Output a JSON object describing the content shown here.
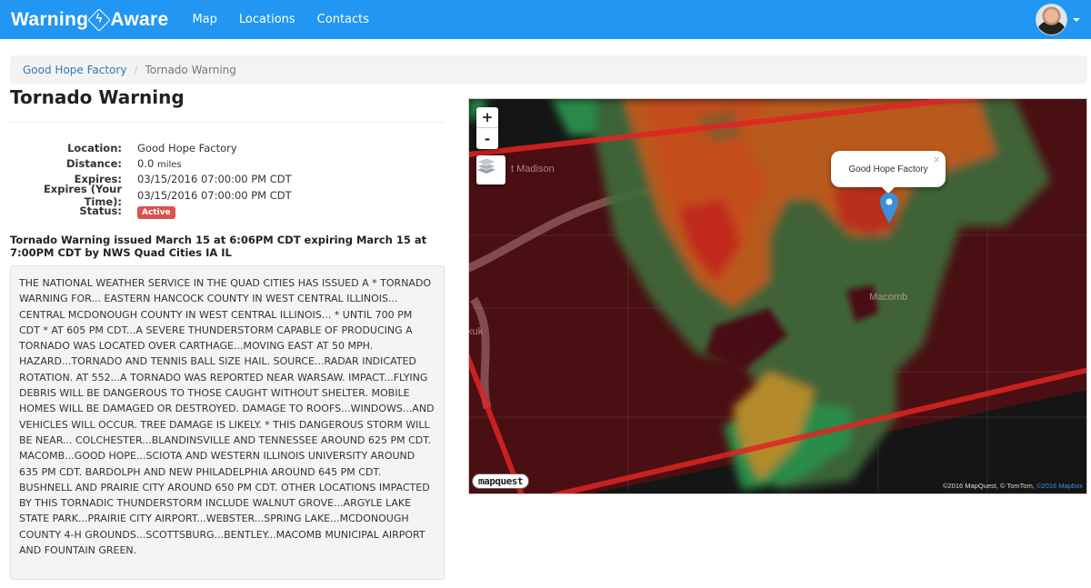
{
  "navbar": {
    "brand_part1": "Warning",
    "brand_part2": "Aware",
    "brand_icon": "lightning-bolt-icon",
    "links": [
      "Map",
      "Locations",
      "Contacts"
    ],
    "accent_color": "#2196f3"
  },
  "breadcrumb": {
    "parent": "Good Hope Factory",
    "separator": "/",
    "current": "Tornado Warning"
  },
  "page": {
    "title": "Tornado Warning"
  },
  "details": {
    "location_label": "Location:",
    "location_value": "Good Hope Factory",
    "distance_label": "Distance:",
    "distance_value": "0.0",
    "distance_unit": "miles",
    "expires_label": "Expires:",
    "expires_value": "03/15/2016 07:00:00 PM CDT",
    "expires_local_label": "Expires (Your Time):",
    "expires_local_value": "03/15/2016 07:00:00 PM CDT",
    "status_label": "Status:",
    "status_value": "Active",
    "status_color": "#d9534f"
  },
  "alert": {
    "headline": "Tornado Warning issued March 15 at 6:06PM CDT expiring March 15 at 7:00PM CDT by NWS Quad Cities IA IL",
    "body": "THE NATIONAL WEATHER SERVICE IN THE QUAD CITIES HAS ISSUED A * TORNADO WARNING FOR... EASTERN HANCOCK COUNTY IN WEST CENTRAL ILLINOIS... CENTRAL MCDONOUGH COUNTY IN WEST CENTRAL ILLINOIS... * UNTIL 700 PM CDT * AT 605 PM CDT...A SEVERE THUNDERSTORM CAPABLE OF PRODUCING A TORNADO WAS LOCATED OVER CARTHAGE...MOVING EAST AT 50 MPH. HAZARD...TORNADO AND TENNIS BALL SIZE HAIL. SOURCE...RADAR INDICATED ROTATION. AT 552...A TORNADO WAS REPORTED NEAR WARSAW. IMPACT...FLYING DEBRIS WILL BE DANGEROUS TO THOSE CAUGHT WITHOUT SHELTER. MOBILE HOMES WILL BE DAMAGED OR DESTROYED. DAMAGE TO ROOFS...WINDOWS...AND VEHICLES WILL OCCUR. TREE DAMAGE IS LIKELY. * THIS DANGEROUS STORM WILL BE NEAR... COLCHESTER...BLANDINSVILLE AND TENNESSEE AROUND 625 PM CDT. MACOMB...GOOD HOPE...SCIOTA AND WESTERN ILLINOIS UNIVERSITY AROUND 635 PM CDT. BARDOLPH AND NEW PHILADELPHIA AROUND 645 PM CDT. BUSHNELL AND PRAIRIE CITY AROUND 650 PM CDT. OTHER LOCATIONS IMPACTED BY THIS TORNADIC THUNDERSTORM INCLUDE WALNUT GROVE...ARGYLE LAKE STATE PARK...PRAIRIE CITY AIRPORT...WEBSTER...SPRING LAKE...MCDONOUGH COUNTY 4-H GROUNDS...SCOTTSBURG...BENTLEY...MACOMB MUNICIPAL AIRPORT AND FOUNTAIN GREEN."
  },
  "map": {
    "zoom_in": "+",
    "zoom_out": "-",
    "layers_icon": "layers-icon",
    "labels": [
      "t Madison",
      "Macomb",
      "kuk"
    ],
    "popup_text": "Good Hope Factory",
    "popup_close": "×",
    "logo": "mapquest",
    "attribution_text": "©2016 MapQuest, © TomTom, ",
    "attribution_link": "©2016 Mapbox",
    "warning_polygon_color": "#e02424"
  }
}
